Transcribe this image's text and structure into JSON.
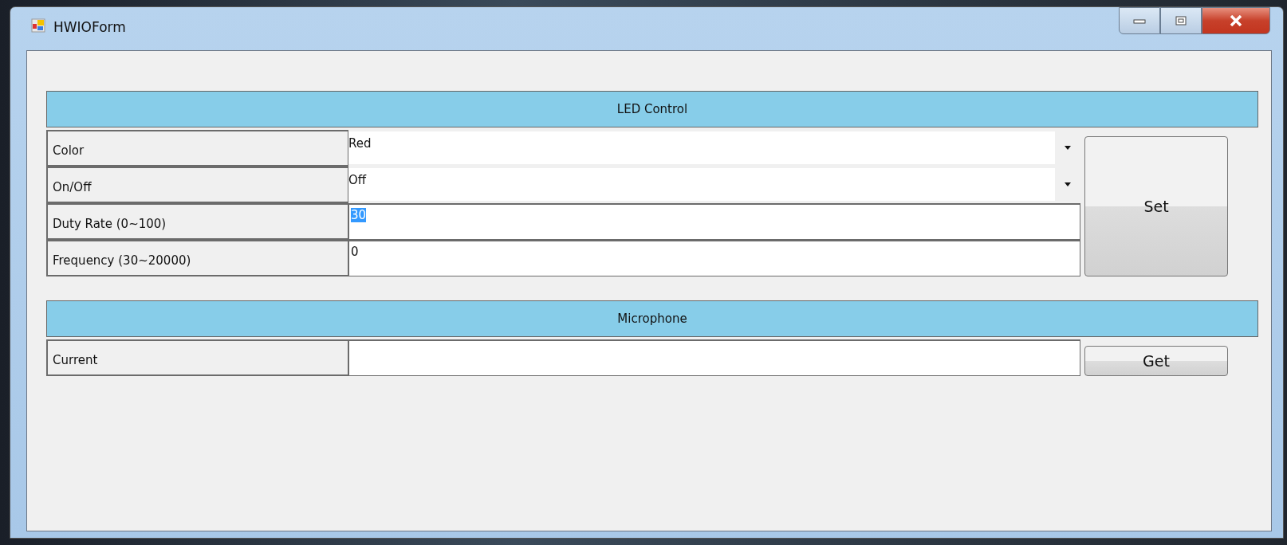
{
  "window": {
    "title": "HWIOForm"
  },
  "sections": [
    {
      "title": "LED Control",
      "button": "Set",
      "rows": [
        {
          "label": "Color",
          "kind": "dropdown",
          "value": "Red"
        },
        {
          "label": "On/Off",
          "kind": "dropdown",
          "value": "Off"
        },
        {
          "label": "Duty Rate (0~100)",
          "kind": "textbox",
          "value": "30",
          "text_selected": true
        },
        {
          "label": "Frequency (30~20000)",
          "kind": "textbox",
          "value": "0",
          "text_selected": false
        }
      ]
    },
    {
      "title": "Microphone",
      "button": "Get",
      "rows": [
        {
          "label": "Current",
          "kind": "textbox",
          "value": ""
        }
      ]
    }
  ]
}
